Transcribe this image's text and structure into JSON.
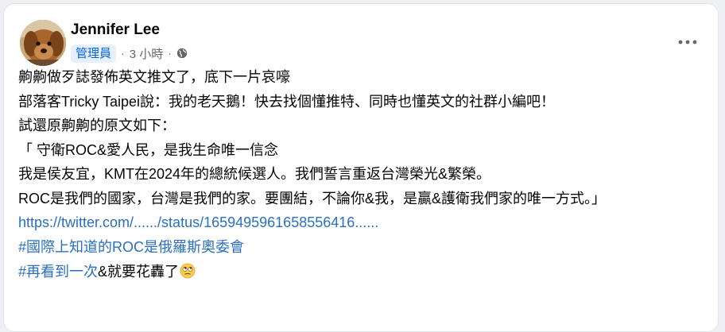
{
  "post": {
    "author_name": "Jennifer Lee",
    "role_badge": "管理員",
    "meta_separator": "·",
    "time_ago": "3 小時",
    "visibility_icon": "globe-icon",
    "more_icon": "more-horizontal-icon",
    "lines": [
      "齁齁做歹誌發佈英文推文了，底下一片哀嚎",
      "部落客Tricky Taipei說：我的老天鵝！快去找個懂推特、同時也懂英文的社群小編吧！",
      "試還原齁齁的原文如下：",
      "「 守衛ROC&愛人民，是我生命唯一信念",
      "我是侯友宜，KMT在2024年的總統候選人。我們誓言重返台灣榮光&繁榮。",
      "ROC是我們的國家，台灣是我們的家。要團結，不論你&我，是贏&護衛我們家的唯一方式。」"
    ],
    "link_url": "https://twitter.com/....../status/1659495961658556416......",
    "hashtag_1": "#國際上知道的ROC是俄羅斯奧委會",
    "hashtag_2": "#再看到一次",
    "line_last_tail": "&就要花轟了",
    "emoji_icon": "rolling-eyes-emoji-icon"
  },
  "colors": {
    "link": "#2a6fc0",
    "badge_bg": "#e7f0fe",
    "badge_text": "#0a64d6",
    "secondary_text": "#65676b"
  }
}
